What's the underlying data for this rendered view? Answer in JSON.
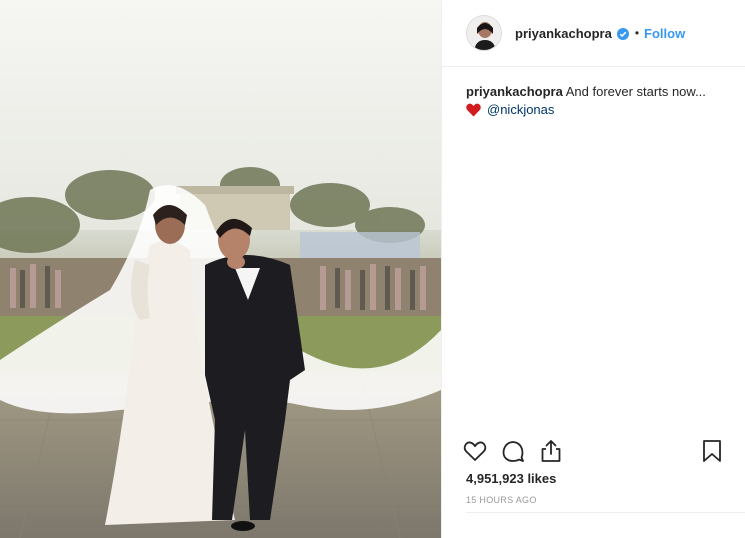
{
  "post": {
    "username": "priyankachopra",
    "verified": true,
    "separator": "•",
    "follow_label": "Follow",
    "caption": {
      "username": "priyankachopra",
      "text": "And forever starts now...",
      "mention": "@nickjonas"
    },
    "likes": "4,951,923 likes",
    "timestamp": "15 HOURS AGO"
  },
  "icons": {
    "verified": "verified-badge-icon",
    "heart_emoji": "red-heart-emoji",
    "like": "heart-outline-icon",
    "comment": "speech-bubble-icon",
    "share": "share-upload-icon",
    "save": "bookmark-icon"
  },
  "colors": {
    "link_blue": "#3897f0",
    "mention_blue": "#003569",
    "verified_blue": "#3897f0",
    "heart_red": "#d01c1f",
    "muted": "#999999",
    "text": "#262626"
  }
}
